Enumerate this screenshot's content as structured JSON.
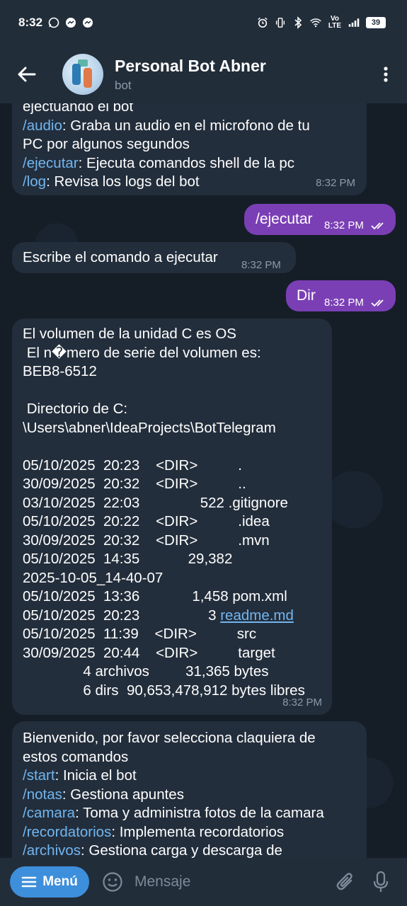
{
  "status_bar": {
    "time": "8:32",
    "battery": "39",
    "network": "Vo LTE"
  },
  "header": {
    "title": "Personal Bot Abner",
    "subtitle": "bot"
  },
  "messages": {
    "m1": {
      "lines": [
        {
          "text": "ejectuando el bot"
        },
        {
          "cmd": "/audio",
          "rest": ": Graba un audio en el microfono de tu"
        },
        {
          "text": "PC por algunos segundos"
        },
        {
          "cmd": "/ejecutar",
          "rest": ": Ejecuta comandos shell de la pc"
        },
        {
          "cmd": "/log",
          "rest": ": Revisa los logs del bot"
        }
      ],
      "time": "8:32 PM"
    },
    "m2": {
      "text": "/ejecutar",
      "time": "8:32 PM"
    },
    "m3": {
      "text": "Escribe el comando a ejecutar",
      "time": "8:32 PM"
    },
    "m4": {
      "text": "Dir",
      "time": "8:32 PM"
    },
    "m5": {
      "lines": [
        "El volumen de la unidad C es OS",
        " El n�mero de serie del volumen es:",
        "BEB8-6512",
        "",
        " Directorio de C:",
        "\\Users\\abner\\IdeaProjects\\BotTelegram",
        "",
        "05/10/2025  20:23    <DIR>          .",
        "30/09/2025  20:32    <DIR>          ..",
        "03/10/2025  22:03               522 .gitignore",
        "05/10/2025  20:22    <DIR>          .idea",
        "30/09/2025  20:32    <DIR>          .mvn",
        "05/10/2025  14:35            29,382",
        "2025-10-05_14-40-07",
        "05/10/2025  13:36             1,458 pom.xml",
        "05/10/2025  20:23                 3 ",
        "05/10/2025  11:39    <DIR>          src",
        "30/09/2025  20:44    <DIR>          target",
        "               4 archivos         31,365 bytes",
        "               6 dirs  90,653,478,912 bytes libres"
      ],
      "link_text": "readme.md",
      "time": "8:32 PM"
    },
    "m6": {
      "lines": [
        {
          "text": "Bienvenido, por favor selecciona claquiera de"
        },
        {
          "text": "estos comandos"
        },
        {
          "cmd": "/start",
          "rest": ": Inicia el bot"
        },
        {
          "cmd": "/notas",
          "rest": ": Gestiona apuntes"
        },
        {
          "cmd": "/camara",
          "rest": ": Toma y administra fotos de la camara"
        },
        {
          "cmd": "/recordatorios",
          "rest": ": Implementa recordatorios"
        },
        {
          "cmd": "/archivos",
          "rest": ": Gestiona carga y descarga de"
        }
      ]
    }
  },
  "bottom_bar": {
    "menu_label": "Menú",
    "input_placeholder": "Mensaje"
  },
  "colors": {
    "background": "#151e27",
    "bar": "#222d3a",
    "incoming_bubble": "#232e3c",
    "outgoing_bubble": "#7b3fb5",
    "command_link": "#71b6f0",
    "menu_button": "#3e8fdb"
  },
  "icons": [
    "back-arrow-icon",
    "more-vertical-icon",
    "whatsapp-icon",
    "messenger-icon",
    "alarm-icon",
    "vibrate-icon",
    "bluetooth-icon",
    "wifi-icon",
    "signal-icon",
    "battery-icon",
    "read-ticks-icon",
    "menu-icon",
    "emoji-icon",
    "attach-icon",
    "mic-icon"
  ]
}
